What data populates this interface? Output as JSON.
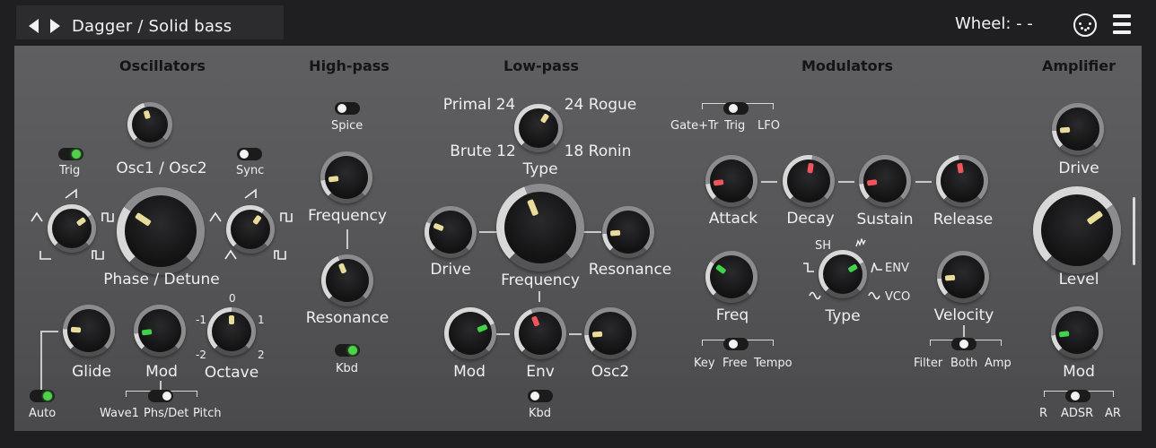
{
  "header": {
    "preset_name": "Dagger / Solid bass",
    "wheel_label": "Wheel: - -"
  },
  "sections": {
    "oscillators": "Oscillators",
    "highpass": "High-pass",
    "lowpass": "Low-pass",
    "modulators": "Modulators",
    "amplifier": "Amplifier"
  },
  "oscillators": {
    "osc_mix": "Osc1 / Osc2",
    "trig": "Trig",
    "sync": "Sync",
    "phase_detune": "Phase / Detune",
    "glide": "Glide",
    "mod": "Mod",
    "octave": "Octave",
    "octave_ticks": [
      "0",
      "-1",
      "1",
      "-2",
      "2"
    ],
    "auto": "Auto",
    "mod_dest": [
      "Wave1",
      "Phs/Det",
      "Pitch"
    ]
  },
  "highpass": {
    "spice": "Spice",
    "frequency": "Frequency",
    "resonance": "Resonance",
    "kbd": "Kbd"
  },
  "lowpass": {
    "type_options": [
      "Primal 24",
      "24 Rogue",
      "Brute 12",
      "18 Ronin"
    ],
    "type": "Type",
    "drive": "Drive",
    "frequency": "Frequency",
    "resonance": "Resonance",
    "mod": "Mod",
    "env": "Env",
    "osc2": "Osc2",
    "kbd": "Kbd"
  },
  "modulators": {
    "trig_mode": [
      "Gate+Tr",
      "Trig",
      "LFO"
    ],
    "attack": "Attack",
    "decay": "Decay",
    "sustain": "Sustain",
    "release": "Release",
    "freq": "Freq",
    "lfo_types": [
      "SH",
      "ENV",
      "VCO"
    ],
    "type": "Type",
    "velocity": "Velocity",
    "freq_mode": [
      "Key",
      "Free",
      "Tempo"
    ],
    "vel_dest": [
      "Filter",
      "Both",
      "Amp"
    ]
  },
  "amplifier": {
    "drive": "Drive",
    "level": "Level",
    "mod": "Mod",
    "env_mode": [
      "R",
      "ADSR",
      "AR"
    ]
  },
  "colors": {
    "indicator_yellow": "#e9dc9a",
    "indicator_red": "#f0555c",
    "indicator_green": "#3fd24a",
    "led_on": "#4fd14a",
    "panel": "#58585a",
    "background": "#1f1f21"
  },
  "knob_levels": {
    "osc_mix": 0.44,
    "osc1_wave": 0.7,
    "phase_detune": 0.29,
    "osc2_wave": 0.63,
    "glide": 0.18,
    "osc_mod": 0.14,
    "octave": 0.5,
    "hp_frequency": 0.14,
    "hp_resonance": 0.42,
    "lp_type": 0.62,
    "lp_drive": 0.25,
    "lp_frequency": 0.42,
    "lp_resonance": 0.15,
    "lp_mod": 0.75,
    "lp_env": 0.42,
    "lp_osc2": 0.15,
    "attack": 0.14,
    "decay": 0.53,
    "sustain": 0.14,
    "release": 0.47,
    "lfo_freq": 0.3,
    "lfo_type": 0.72,
    "velocity": 0.15,
    "amp_drive": 0.15,
    "amp_level": 0.7,
    "amp_mod": 0.14
  }
}
